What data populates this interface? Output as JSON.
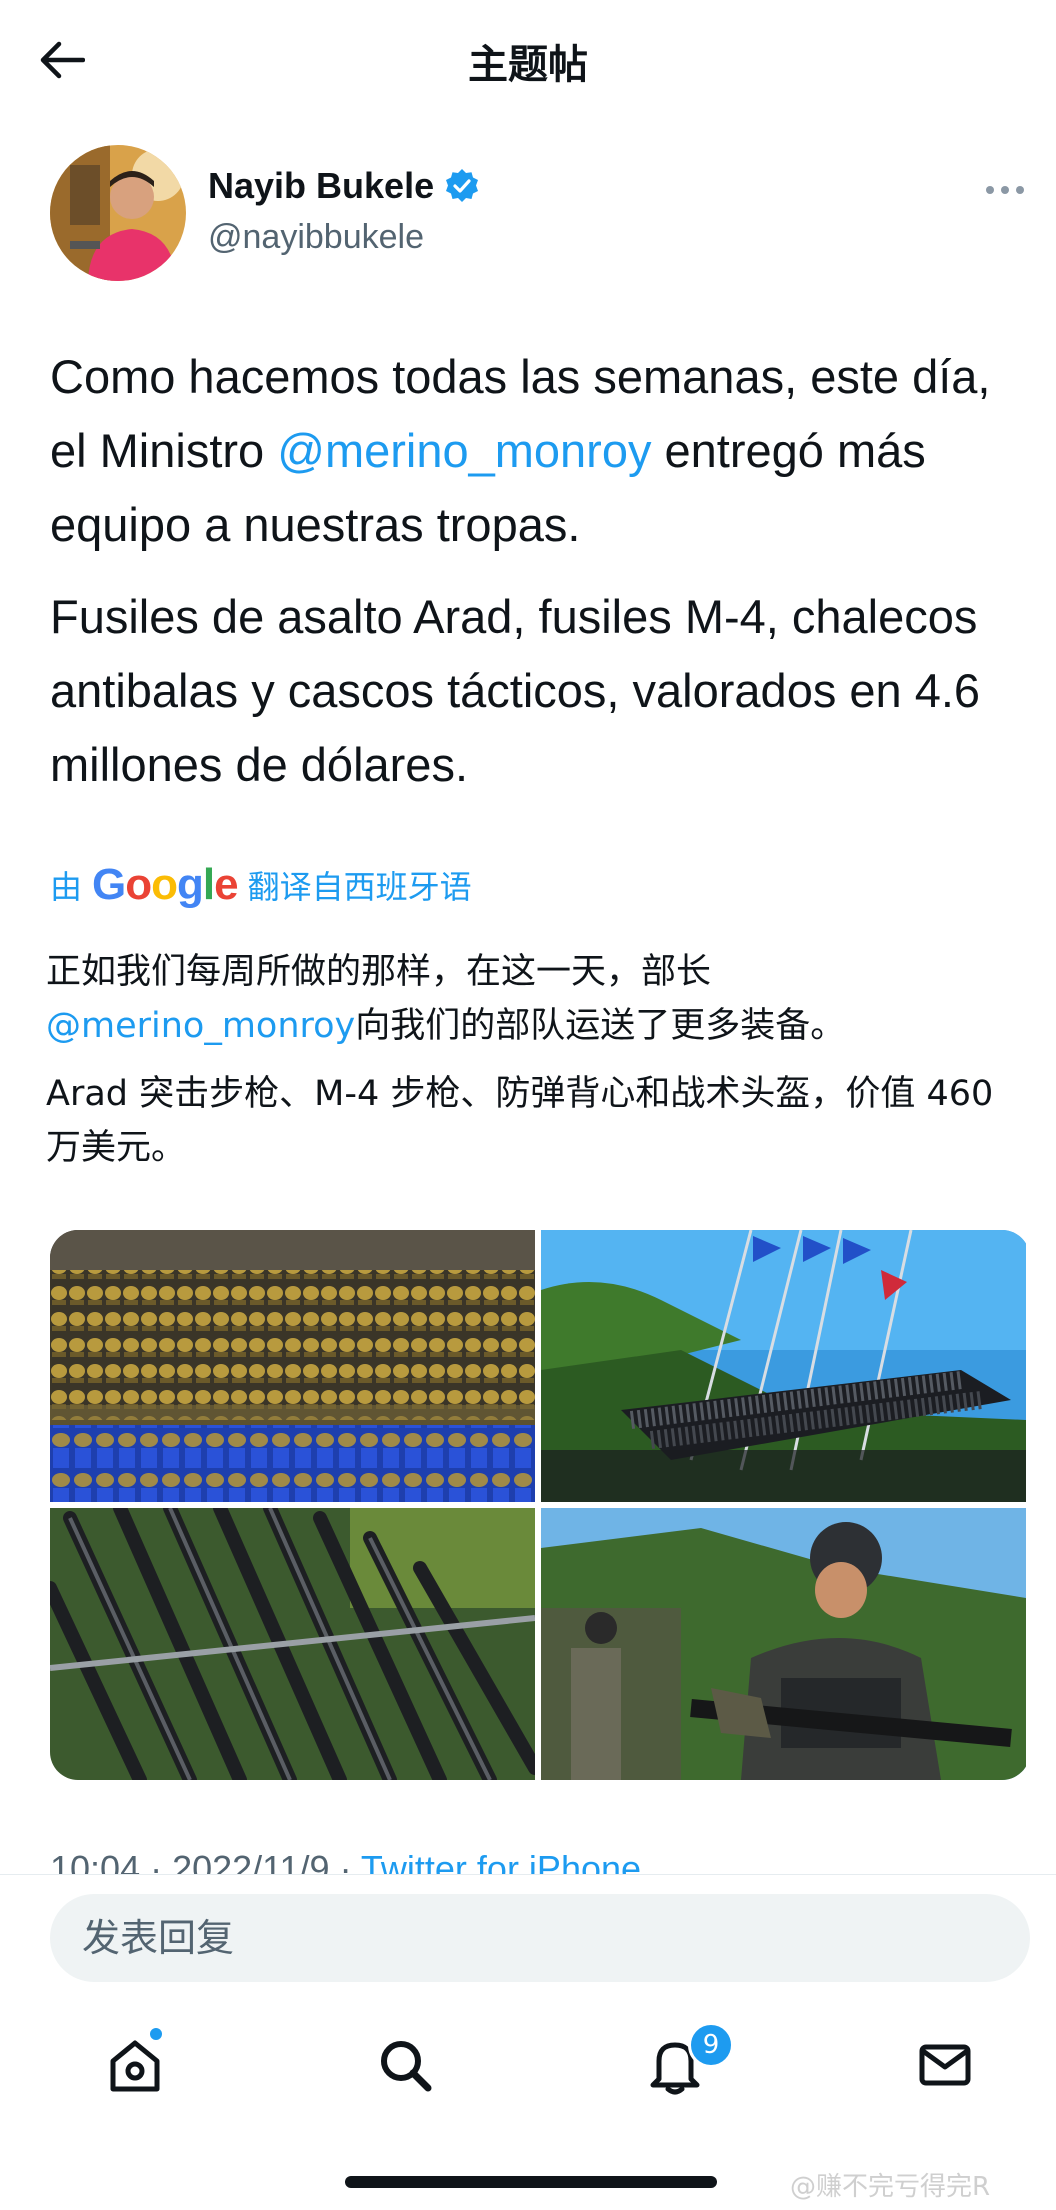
{
  "header": {
    "title": "主题帖"
  },
  "author": {
    "name": "Nayib Bukele",
    "handle": "@nayibbukele",
    "verified": true
  },
  "tweet": {
    "p1_before": "Como hacemos todas las semanas, este día, el Ministro ",
    "p1_mention": "@merino_monroy",
    "p1_after": " entregó más equipo a nuestras tropas.",
    "p2": "Fusiles de asalto Arad, fusiles M-4, chalecos antibalas y cascos tácticos, valorados en 4.6 millones de dólares."
  },
  "translation": {
    "by": "由",
    "brand": "Google",
    "label": "翻译自西班牙语",
    "p1_before": "正如我们每周所做的那样，在这一天，部长",
    "p1_mention": "@merino_monroy",
    "p1_after": "向我们的部队运送了更多装备。",
    "p2": "Arad 突击步枪、M-4 步枪、防弹背心和战术头盔，价值 460 万美元。"
  },
  "meta": {
    "time": "10:04 · 2022/11/9 · ",
    "source": "Twitter for iPhone"
  },
  "reply": {
    "placeholder": "发表回复"
  },
  "nav": {
    "notifications_badge": "9"
  },
  "watermark": "@赚不完亏得完R",
  "colors": {
    "accent": "#1d9bf0",
    "text": "#0f1419",
    "secondary": "#536471"
  }
}
